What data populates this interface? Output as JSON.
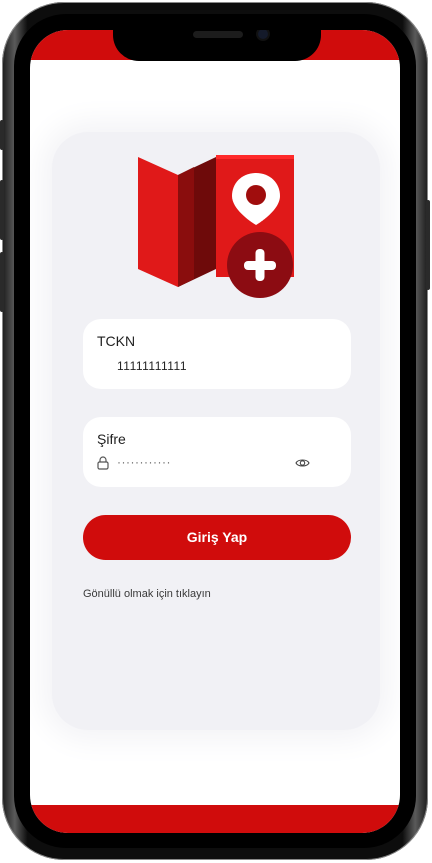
{
  "login_form": {
    "tckn_label": "TCKN",
    "tckn_value": "11111111111",
    "password_label": "Şifre",
    "password_mask": "············",
    "login_button_label": "Giriş Yap",
    "volunteer_link_text": "Gönüllü olmak için tıklayın"
  },
  "icons": {
    "logo": "map-with-location-pin-and-plus-icon",
    "lock": "lock-icon",
    "eye": "eye-icon"
  },
  "colors": {
    "accent": "#d00c0c",
    "card_background": "#f1f1f5",
    "screen_background": "#ffffff"
  }
}
